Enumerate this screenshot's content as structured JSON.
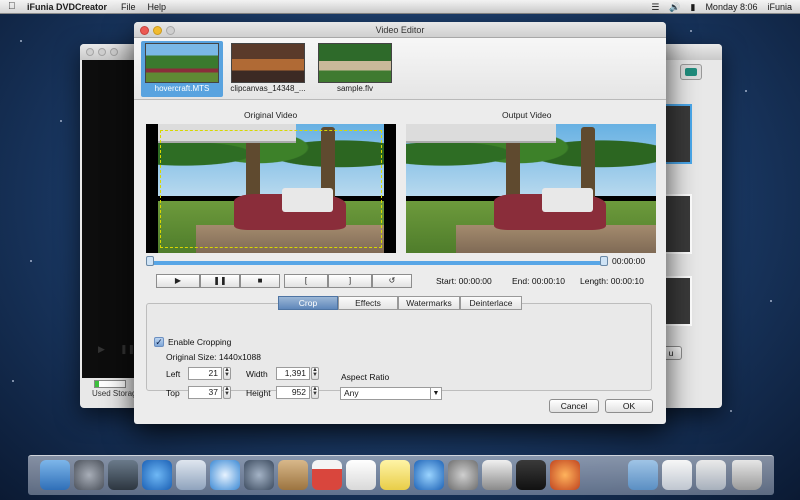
{
  "menubar": {
    "app_name": "iFunia DVDCreator",
    "menus": [
      "File",
      "Help"
    ],
    "clock": "Monday  8:06",
    "user": "iFunia"
  },
  "background_window": {
    "storage_label": "Used Storage",
    "storage_fill": 0.12,
    "button_label": "u"
  },
  "editor": {
    "title": "Video Editor",
    "clips": [
      {
        "label": "hovercraft.MTS",
        "selected": true
      },
      {
        "label": "clipcanvas_14348_...",
        "selected": false
      },
      {
        "label": "sample.flv",
        "selected": false
      }
    ],
    "original_label": "Original Video",
    "output_label": "Output Video",
    "current_time": "00:00:00",
    "playback": {
      "play": "▶",
      "pause": "❚❚",
      "stop": "■",
      "mark_in": "[",
      "mark_out": "]",
      "reset": "↺"
    },
    "times": {
      "start": "Start: 00:00:00",
      "end": "End: 00:00:10",
      "length": "Length: 00:00:10"
    },
    "tabs": [
      "Crop",
      "Effects",
      "Watermarks",
      "Deinterlace"
    ],
    "active_tab": "Crop",
    "crop": {
      "enable_label": "Enable Cropping",
      "enabled": true,
      "original_size": "Original Size:  1440x1088",
      "left_label": "Left",
      "left_value": "21",
      "top_label": "Top",
      "top_value": "37",
      "width_label": "Width",
      "width_value": "1,391",
      "height_label": "Height",
      "height_value": "952",
      "aspect_label": "Aspect Ratio",
      "aspect_value": "Any"
    },
    "cancel_label": "Cancel",
    "ok_label": "OK"
  },
  "icons": {
    "apple": "apple-icon",
    "wifi": "wifi-icon",
    "battery": "battery-icon",
    "volume": "volume-icon",
    "search": "spotlight-icon"
  }
}
